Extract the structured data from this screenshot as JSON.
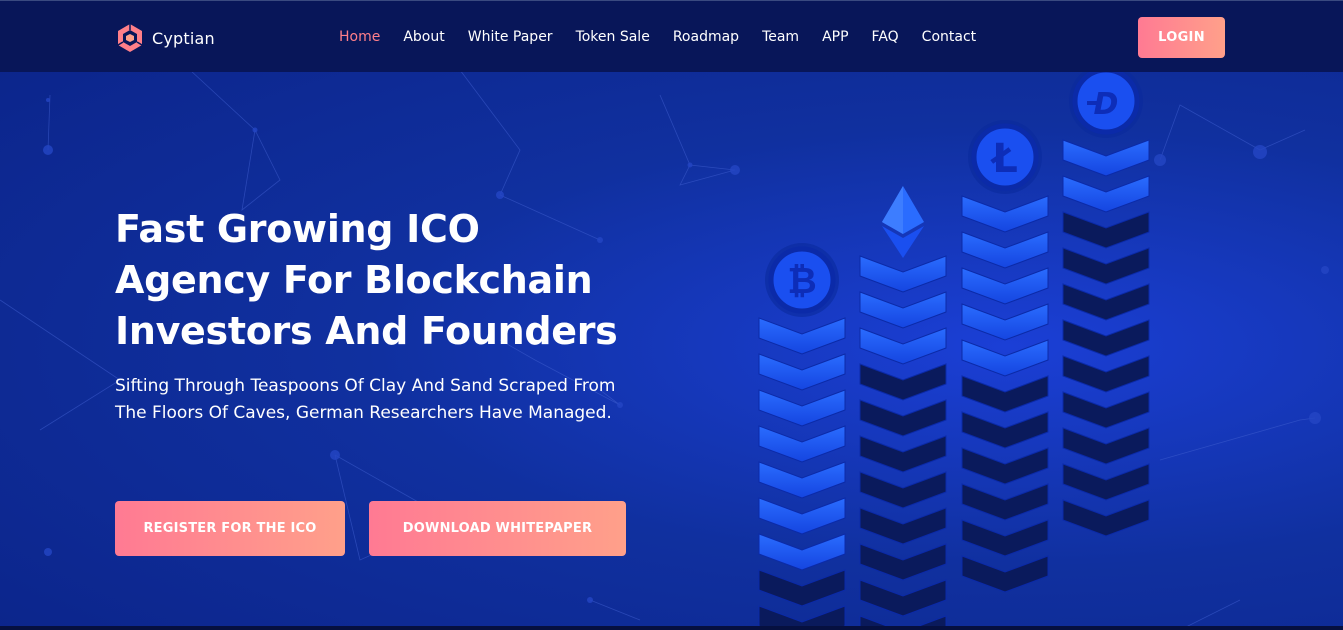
{
  "brand": {
    "name": "Cyptian",
    "logo_icon": "hexagon-logo-icon",
    "accent": "#ff7f89"
  },
  "nav": {
    "items": [
      {
        "label": "Home",
        "active": true
      },
      {
        "label": "About",
        "active": false
      },
      {
        "label": "White Paper",
        "active": false
      },
      {
        "label": "Token Sale",
        "active": false
      },
      {
        "label": "Roadmap",
        "active": false
      },
      {
        "label": "Team",
        "active": false
      },
      {
        "label": "APP",
        "active": false
      },
      {
        "label": "FAQ",
        "active": false
      },
      {
        "label": "Contact",
        "active": false
      }
    ],
    "login_label": "LOGIN"
  },
  "hero": {
    "headline_lines": [
      "Fast Growing ICO",
      "Agency For Blockchain",
      "Investors And Founders"
    ],
    "subtext": "Sifting Through Teaspoons Of Clay And Sand Scraped From The Floors Of Caves, German Researchers Have Managed.",
    "register_label": "REGISTER FOR THE ICO",
    "download_label": "DOWNLOAD WHITEPAPER"
  },
  "illustration": {
    "coins": [
      "bitcoin-icon",
      "ethereum-icon",
      "litecoin-icon",
      "dash-icon"
    ],
    "colors": {
      "bright": "#1f5bff",
      "mid": "#1341d8",
      "dark": "#0a1a5c",
      "background": "#10309f"
    }
  }
}
